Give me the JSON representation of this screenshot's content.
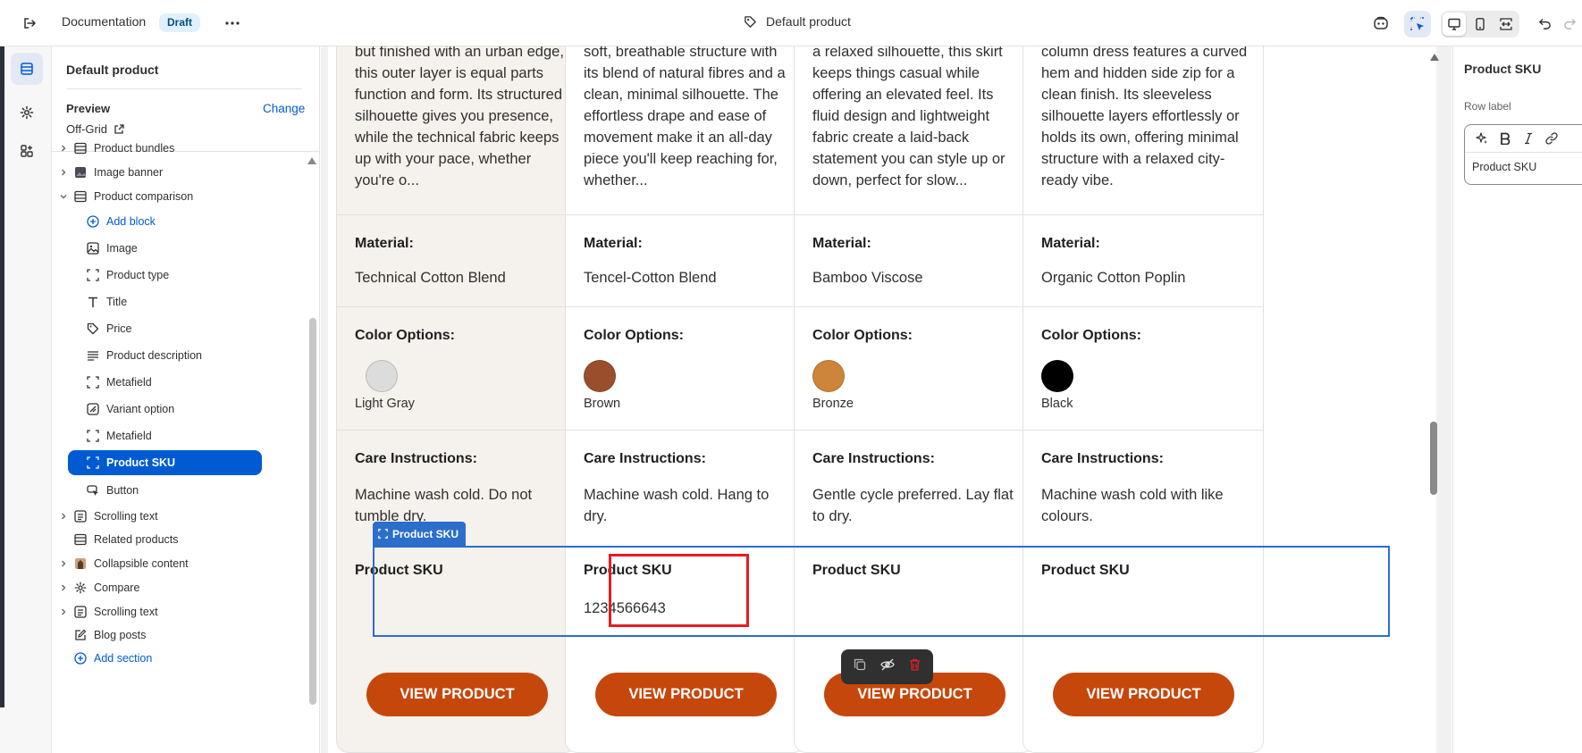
{
  "topbar": {
    "doc_title": "Documentation",
    "status_badge": "Draft",
    "page_title": "Default product"
  },
  "sidebar": {
    "title": "Default product",
    "preview_label": "Preview",
    "change_link": "Change",
    "preview_value": "Off-Grid",
    "items": [
      {
        "label": "Product bundles"
      },
      {
        "label": "Image banner"
      },
      {
        "label": "Product comparison"
      },
      {
        "label": "Add block"
      },
      {
        "label": "Image"
      },
      {
        "label": "Product type"
      },
      {
        "label": "Title"
      },
      {
        "label": "Price"
      },
      {
        "label": "Product description"
      },
      {
        "label": "Metafield"
      },
      {
        "label": "Variant option"
      },
      {
        "label": "Metafield"
      },
      {
        "label": "Product SKU"
      },
      {
        "label": "Button"
      },
      {
        "label": "Scrolling text"
      },
      {
        "label": "Related products"
      },
      {
        "label": "Collapsible content"
      },
      {
        "label": "Compare"
      },
      {
        "label": "Scrolling text"
      },
      {
        "label": "Blog posts"
      },
      {
        "label": "Add section"
      }
    ]
  },
  "comparison": {
    "material_label": "Material:",
    "color_label": "Color Options:",
    "care_label": "Care Instructions:",
    "sku_label": "Product SKU",
    "sku_tag": "Product SKU",
    "button_label": "VIEW PRODUCT",
    "products": [
      {
        "desc": "but finished with an urban edge, this outer layer is equal parts function and form. Its structured silhouette gives you presence, while the technical fabric keeps up with your pace, whether you're o...",
        "material": "Technical Cotton Blend",
        "color_name": "Light Gray",
        "color_hex": "#dcdcdc",
        "care": "Machine wash cold. Do not tumble dry.",
        "sku": ""
      },
      {
        "desc": "soft, breathable structure with its blend of natural fibres and a clean, minimal silhouette. The effortless drape and ease of movement make it an all-day piece you'll keep reaching for, whether...",
        "material": "Tencel-Cotton Blend",
        "color_name": "Brown",
        "color_hex": "#9a4f2c",
        "care": "Machine wash cold. Hang to dry.",
        "sku": "1234566643"
      },
      {
        "desc": "a relaxed silhouette, this skirt keeps things casual while offering an elevated feel. Its fluid design and lightweight fabric create a laid-back statement you can style up or down, perfect for slow...",
        "material": "Bamboo Viscose",
        "color_name": "Bronze",
        "color_hex": "#cd853a",
        "care": "Gentle cycle preferred. Lay flat to dry.",
        "sku": ""
      },
      {
        "desc": "column dress features a curved hem and hidden side zip for a clean finish. Its sleeveless silhouette layers effortlessly or holds its own, offering minimal structure with a relaxed city-ready vibe.",
        "material": "Organic Cotton Poplin",
        "color_name": "Black",
        "color_hex": "#000000",
        "care": "Machine wash cold with like colours.",
        "sku": ""
      }
    ]
  },
  "right_panel": {
    "title": "Product SKU",
    "row_label": "Row label",
    "row_label_value": "Product SKU"
  },
  "colors": {
    "accent": "#005bd3",
    "button": "#c6470b",
    "selection": "#2c6ecb",
    "highlight": "#e51c23"
  }
}
